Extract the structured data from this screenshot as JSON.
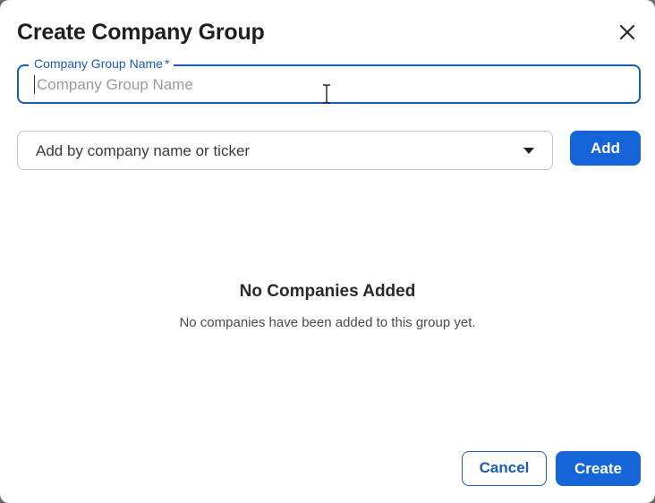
{
  "dialog": {
    "title": "Create Company Group",
    "close_icon": "close-icon"
  },
  "name_field": {
    "label": "Company Group Name",
    "required_marker": "*",
    "placeholder": "Company Group Name",
    "value": ""
  },
  "company_select": {
    "placeholder": "Add by company name or ticker",
    "arrow_icon": "caret-down-icon"
  },
  "add_button": {
    "label": "Add"
  },
  "empty_state": {
    "title": "No Companies Added",
    "message": "No companies have been added to this group yet."
  },
  "footer": {
    "cancel_label": "Cancel",
    "create_label": "Create"
  },
  "colors": {
    "primary": "#1565d8",
    "focus_border": "#1b5cb8",
    "text": "#1f1f1f",
    "muted": "#9a9a9a",
    "border": "#c4c4c4"
  }
}
